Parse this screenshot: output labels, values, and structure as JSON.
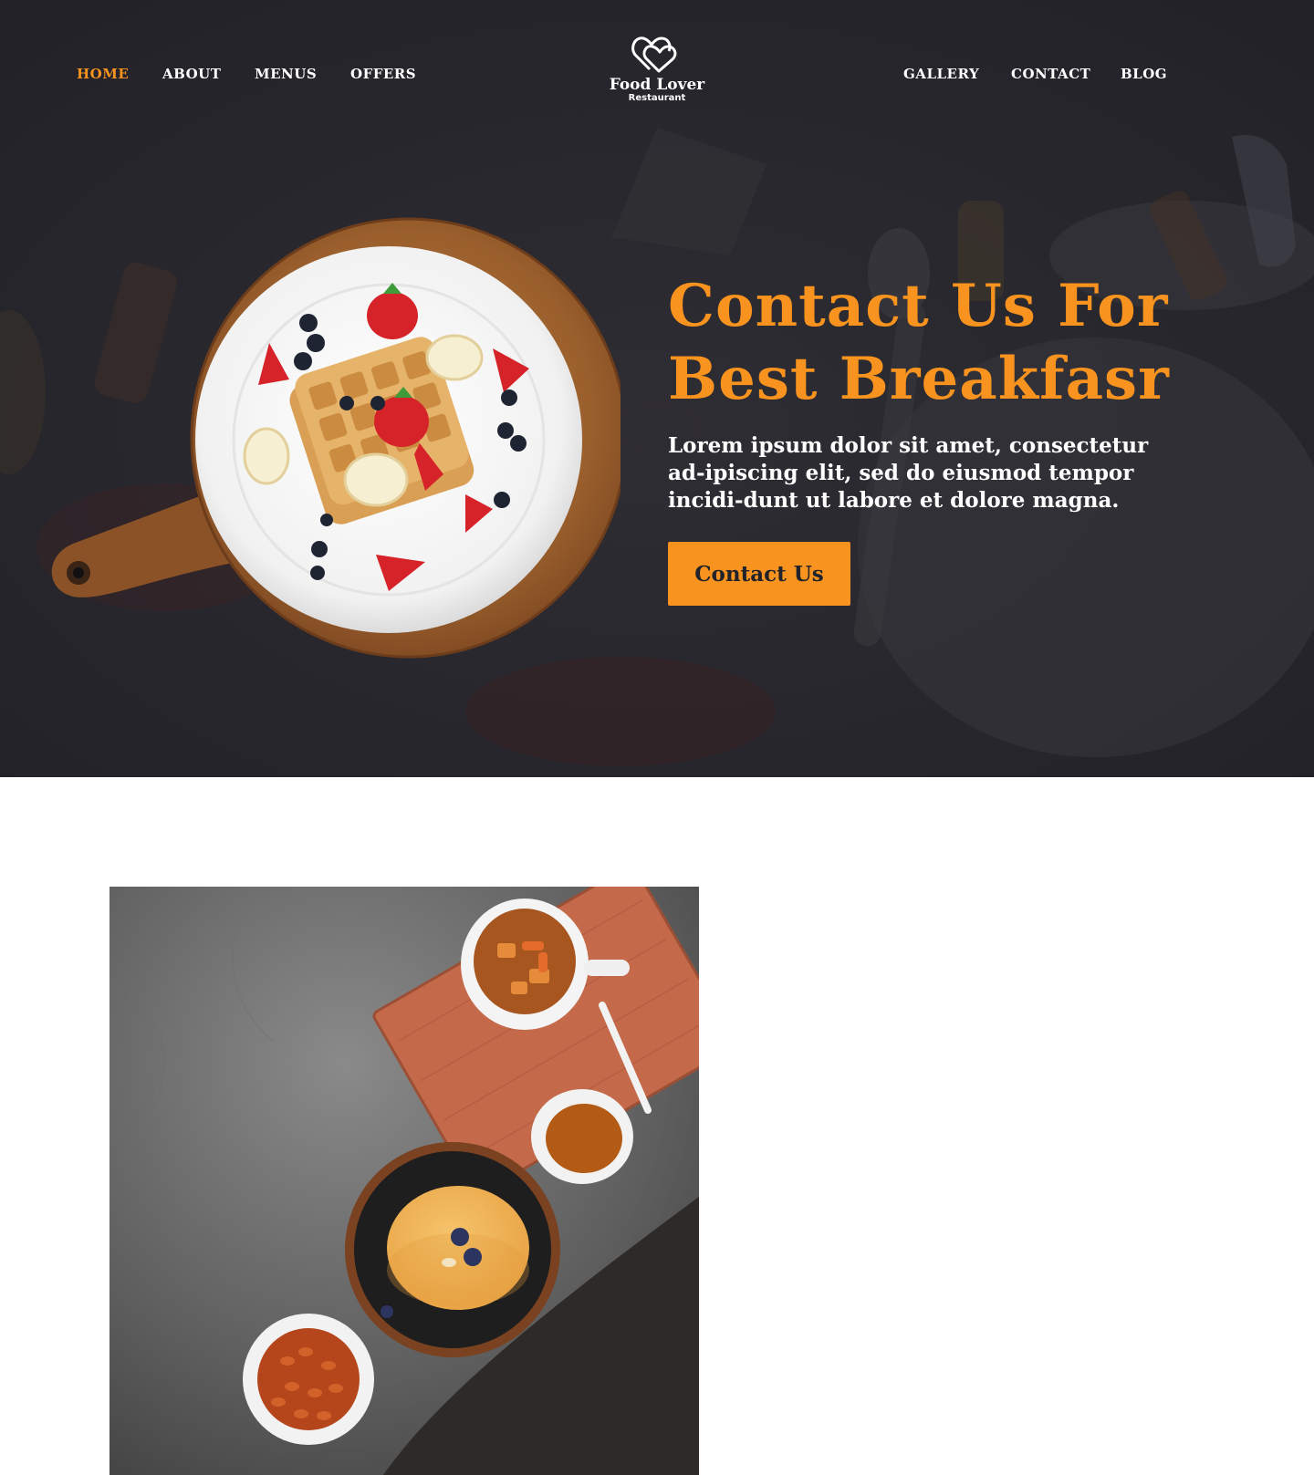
{
  "nav": {
    "left_items": [
      {
        "label": "HOME",
        "active": true
      },
      {
        "label": "ABOUT",
        "active": false
      },
      {
        "label": "MENUS",
        "active": false
      },
      {
        "label": "OFFERS",
        "active": false
      }
    ],
    "right_items": [
      {
        "label": "GALLERY",
        "active": false
      },
      {
        "label": "CONTACT",
        "active": false
      },
      {
        "label": "BLOG",
        "active": false
      }
    ]
  },
  "logo": {
    "icon": "double-heart-icon",
    "name": "Food Lover",
    "subtitle": "Restaurant"
  },
  "hero": {
    "title_line1": "Contact Us For",
    "title_line2": "Best Breakfasr",
    "body": "Lorem ipsum dolor sit amet, consectetur ad-ipiscing elit, sed do eiusmod tempor incidi-dunt ut labore et dolore magna.",
    "cta_label": "Contact Us"
  },
  "colors": {
    "accent": "#f7931e",
    "hero_background": "#24242a",
    "text_light": "#ffffff"
  }
}
